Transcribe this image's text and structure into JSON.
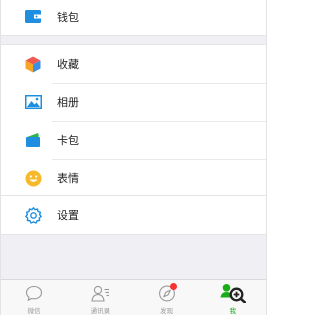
{
  "menu": {
    "wallet": {
      "label": "钱包",
      "icon": "wallet-icon"
    },
    "favorites": {
      "label": "收藏",
      "icon": "cube-icon"
    },
    "album": {
      "label": "相册",
      "icon": "photo-icon"
    },
    "cards": {
      "label": "卡包",
      "icon": "card-icon"
    },
    "stickers": {
      "label": "表情",
      "icon": "smiley-icon"
    },
    "settings": {
      "label": "设置",
      "icon": "gear-icon"
    }
  },
  "tabbar": {
    "tabs": [
      {
        "label": "微信",
        "icon": "chat-bubble-icon"
      },
      {
        "label": "通讯录",
        "icon": "contacts-icon"
      },
      {
        "label": "发现",
        "icon": "compass-icon",
        "badge": true
      },
      {
        "label": "我",
        "icon": "me-icon",
        "active": true
      }
    ]
  },
  "colors": {
    "accent": "#1aad19",
    "blue_icon": "#1e8fe0",
    "badge": "#f43530",
    "background": "#efeff4"
  }
}
